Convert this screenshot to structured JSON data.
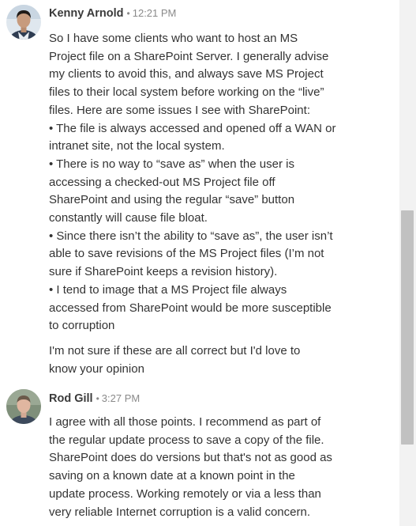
{
  "messages": [
    {
      "author": "Kenny Arnold",
      "separator": "•",
      "time": "12:21 PM",
      "paragraphs": [
        [
          "So I have some clients who want to host an MS",
          "Project file on a SharePoint Server. I generally advise",
          "my clients to avoid this, and always save MS Project",
          "files to their local system before working on the “live”",
          "files. Here are some issues I see with SharePoint:",
          "• The file is always accessed and opened off a WAN or",
          "intranet site, not the local system.",
          "• There is no way to “save as” when the user is",
          "accessing a checked-out MS Project file off",
          "SharePoint and using the regular “save” button",
          "constantly will cause file bloat.",
          "• Since there isn’t the ability to “save as”, the user isn’t",
          "able to save revisions of the MS Project files (I’m not",
          "sure if SharePoint keeps a revision history).",
          "• I tend to image that a MS Project file always",
          "accessed from SharePoint would be more susceptible",
          "to corruption"
        ],
        [
          "I'm not sure if these are all correct but I'd love to",
          "know your opinion"
        ]
      ]
    },
    {
      "author": "Rod Gill",
      "separator": "•",
      "time": "3:27 PM",
      "paragraphs": [
        [
          "I agree with all those points. I recommend as part of",
          "the regular update process to save a copy of the file.",
          "SharePoint does do versions but that's not as good as",
          "saving on a known date at a known point in the",
          "update process. Working remotely or via a less than",
          "very reliable Internet corruption is a valid concern."
        ]
      ]
    }
  ],
  "icons": {
    "avatar_1": "avatar-photo",
    "avatar_2": "avatar-photo"
  },
  "colors": {
    "text": "#333333",
    "meta": "#8a8a8a",
    "scroll_track": "#f2f2f2",
    "scroll_thumb": "#c1c1c1"
  }
}
